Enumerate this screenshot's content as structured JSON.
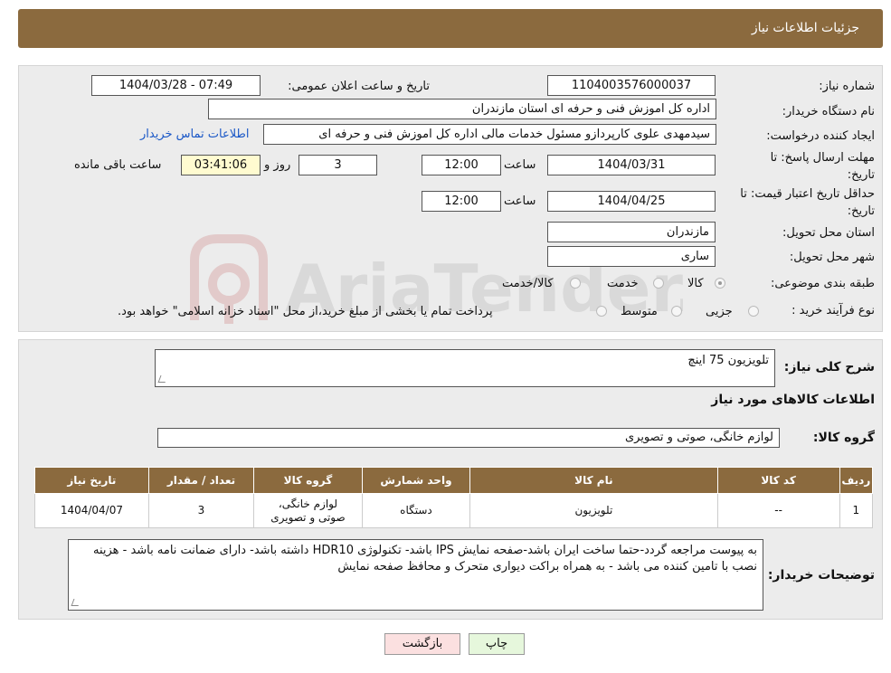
{
  "header": {
    "title": "جزئیات اطلاعات نیاز"
  },
  "form": {
    "need_number_label": "شماره نیاز:",
    "need_number": "1104003576000037",
    "announce_label": "تاریخ و ساعت اعلان عمومی:",
    "announce_value": "1404/03/28 - 07:49",
    "buyer_org_label": "نام دستگاه خریدار:",
    "buyer_org": "اداره کل اموزش فنی و حرفه ای استان مازندران",
    "requester_label": "ایجاد کننده درخواست:",
    "requester": "سیدمهدی  علوی کارپردازو مسئول خدمات مالی اداره کل اموزش فنی و حرفه ای",
    "contact_link": "اطلاعات تماس خریدار",
    "reply_deadline_label": "مهلت ارسال پاسخ: تا تاریخ:",
    "reply_date": "1404/03/31",
    "time_label": "ساعت",
    "reply_time": "12:00",
    "days_value": "3",
    "days_label": "روز و",
    "remaining_time": "03:41:06",
    "remaining_label": "ساعت باقی مانده",
    "validity_label": "حداقل تاریخ اعتبار قیمت: تا تاریخ:",
    "validity_date": "1404/04/25",
    "validity_time": "12:00",
    "province_label": "استان محل تحویل:",
    "province": "مازندران",
    "city_label": "شهر محل تحویل:",
    "city": "ساری",
    "category_label": "طبقه بندی موضوعی:",
    "category_options": [
      "کالا",
      "خدمت",
      "کالا/خدمت"
    ],
    "purchase_type_label": "نوع فرآیند خرید :",
    "purchase_options": [
      "جزیی",
      "متوسط"
    ],
    "purchase_note": "پرداخت تمام یا بخشی از مبلغ خرید،از محل \"اسناد خزانه اسلامی\" خواهد بود."
  },
  "watermark": {
    "text": "AriaTender.neT"
  },
  "details": {
    "summary_label": "شرح کلی نیاز:",
    "summary": "تلویزیون 75 اینچ",
    "goods_info_title": "اطلاعات کالاهای مورد نیاز",
    "goods_group_label": "گروه کالا:",
    "goods_group": "لوازم خانگی، صوتی و تصویری",
    "table": {
      "headers": [
        "ردیف",
        "کد کالا",
        "نام کالا",
        "واحد شمارش",
        "گروه کالا",
        "تعداد / مقدار",
        "تاریخ نیاز"
      ],
      "rows": [
        [
          "1",
          "--",
          "تلویزیون",
          "دستگاه",
          "لوازم خانگی، صوتی و تصویری",
          "3",
          "1404/04/07"
        ]
      ]
    },
    "buyer_notes_label": "توضیحات خریدار:",
    "buyer_notes": "به پیوست مراجعه گردد-حتما ساخت ایران باشد-صفحه نمایش IPS  باشد- تکنولوژی HDR10 داشته باشد- دارای ضمانت نامه باشد - هزینه نصب با تامین کننده می باشد - به همراه براکت دیواری متحرک و محافظ صفحه نمایش"
  },
  "buttons": {
    "print": "چاپ",
    "back": "بازگشت"
  },
  "colors": {
    "header": "#8b6a3e",
    "link": "#1b58c7",
    "print_bg": "#e6f7dc",
    "back_bg": "#fbe0e0"
  }
}
